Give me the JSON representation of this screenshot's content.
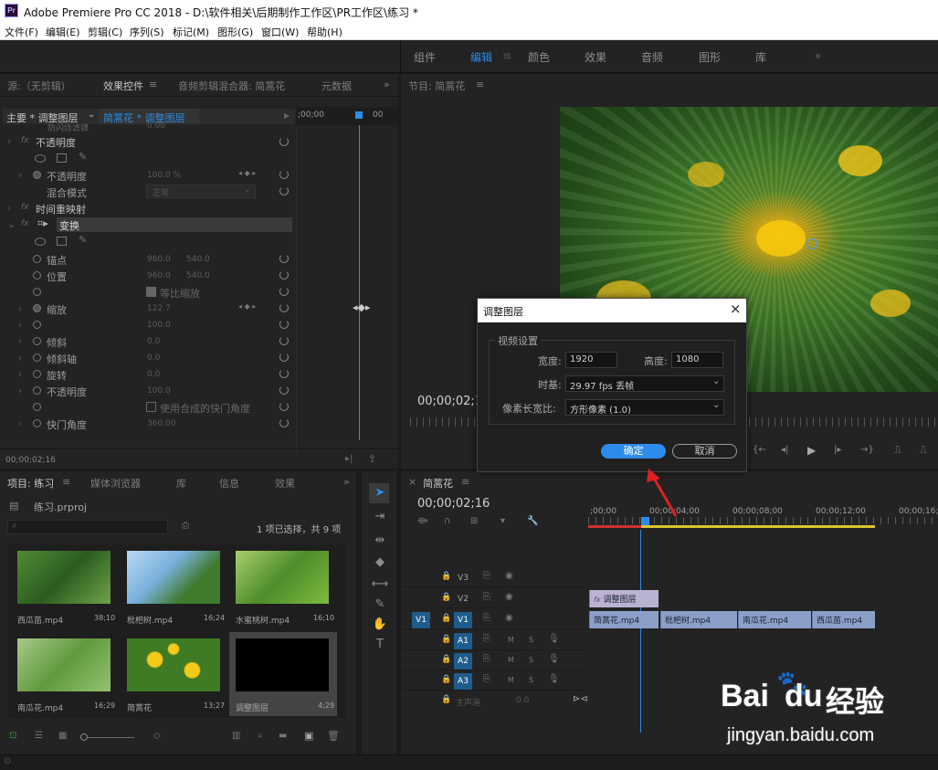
{
  "window": {
    "title": "Adobe Premiere Pro CC 2018 - D:\\软件相关\\后期制作工作区\\PR工作区\\练习 *",
    "icon": "Pr"
  },
  "menu": [
    "文件(F)",
    "编辑(E)",
    "剪辑(C)",
    "序列(S)",
    "标记(M)",
    "图形(G)",
    "窗口(W)",
    "帮助(H)"
  ],
  "workspaces": [
    "组件",
    "编辑",
    "颜色",
    "效果",
    "音频",
    "图形",
    "库"
  ],
  "source_panel": {
    "tabs": [
      "源:（无剪辑）",
      "效果控件",
      "音频剪辑混合器: 简蒿花",
      "元数据"
    ],
    "master_label": "主要 * 调整图层",
    "clip_label": "简蒿花 * 调整图层",
    "ruler_label": ";00;00",
    "ruler_end": "00",
    "partial_row": "防闪烁滤镜",
    "partial_val": "0.00",
    "opacity_section": "不透明度",
    "opacity_label": "不透明度",
    "opacity_val": "100.0 %",
    "blend_label": "混合模式",
    "blend_val": "正常",
    "time_remap": "时间重映射",
    "transform": "变换",
    "anchor_label": "锚点",
    "anchor_x": "960.0",
    "anchor_y": "540.0",
    "position_label": "位置",
    "position_x": "960.0",
    "position_y": "540.0",
    "uniform_label": "等比缩放",
    "scale_label": "缩放",
    "scale_val": "122.7",
    "scale_w_val": "100.0",
    "skew_label": "倾斜",
    "skew_val": "0.0",
    "skew_axis_label": "倾斜轴",
    "skew_axis_val": "0.0",
    "rotation_label": "旋转",
    "rotation_val": "0.0",
    "opacity2_label": "不透明度",
    "opacity2_val": "100.0",
    "composite_label": "使用合成的快门角度",
    "shutter_label": "快门角度",
    "shutter_val": "360.00",
    "timecode": "00;00;02;16"
  },
  "program_panel": {
    "title": "节目: 简蒿花",
    "timecode": "00;00;02;16"
  },
  "dialog": {
    "title": "调整图层",
    "group": "视频设置",
    "width_label": "宽度:",
    "width_val": "1920",
    "height_label": "高度:",
    "height_val": "1080",
    "timebase_label": "时基:",
    "timebase_val": "29.97 fps 丢帧",
    "par_label": "像素长宽比:",
    "par_val": "方形像素 (1.0)",
    "ok": "确定",
    "cancel": "取消"
  },
  "project_panel": {
    "tabs": [
      "项目: 练习",
      "媒体浏览器",
      "库",
      "信息",
      "效果"
    ],
    "file": "练习.prproj",
    "selection": "1 项已选择，共 9 项",
    "items": [
      {
        "name": "西瓜苗.mp4",
        "dur": "38;10",
        "tint": "#3e7a2e"
      },
      {
        "name": "枇杷树.mp4",
        "dur": "16;24",
        "tint": "#88b9df"
      },
      {
        "name": "水蜜桃树.mp4",
        "dur": "16;10",
        "tint": "#5f9a3a"
      },
      {
        "name": "南瓜花.mp4",
        "dur": "16;29",
        "tint": "#7aa85a"
      },
      {
        "name": "简蒿花",
        "dur": "13;27",
        "tint": "#c9a81a"
      },
      {
        "name": "调整图层",
        "dur": "4;29",
        "tint": "#000000"
      }
    ]
  },
  "timeline": {
    "tab": "简蒿花",
    "timecode": "00;00;02;16",
    "ruler": [
      ";00;00",
      "00;00;04;00",
      "00;00;08;00",
      "00;00;12;00",
      "00;00;16;00"
    ],
    "tracks": [
      "V3",
      "V2",
      "V1",
      "A1",
      "A2",
      "A3"
    ],
    "source_track": "V1",
    "master": "主声道",
    "master_val": "0.0",
    "adj_clip": "调整图层",
    "clips": [
      "简蒿花.mp4",
      "枇杷树.mp4",
      "南瓜花.mp4",
      "西瓜苗.mp4"
    ],
    "audio_m": "M",
    "audio_s": "S"
  },
  "watermark": {
    "line1": "Bai",
    "line2": "du",
    "line3": "经验",
    "url": "jingyan.baidu.com"
  }
}
